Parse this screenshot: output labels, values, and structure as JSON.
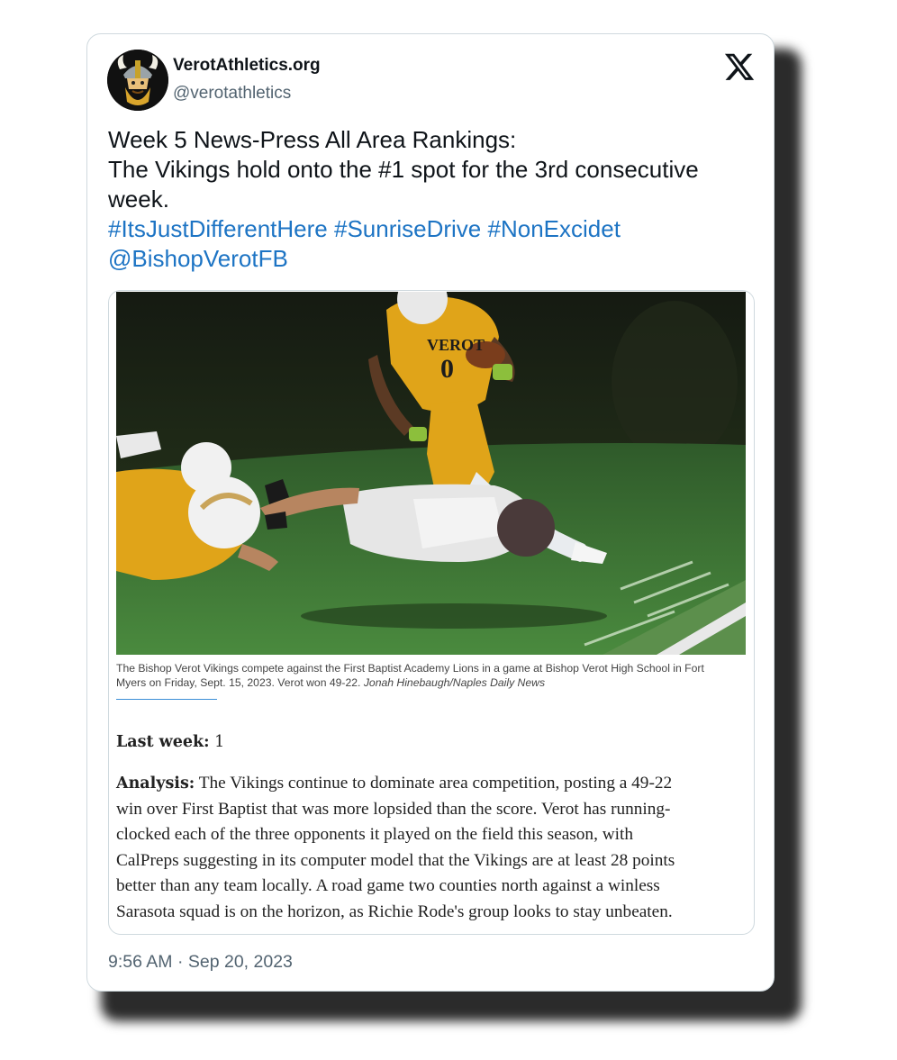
{
  "account": {
    "display_name": "VerotAthletics.org",
    "handle": "@verotathletics",
    "avatar_icon": "viking-mascot-icon"
  },
  "platform_icon": "x-logo-icon",
  "tweet": {
    "line1": "Week 5 News-Press All Area Rankings:",
    "line2": "The Vikings hold onto the #1 spot for the 3rd consecutive",
    "line3": "week.",
    "hashtags": [
      "#ItsJustDifferentHere",
      "#SunriseDrive",
      "#NonExcidet"
    ],
    "mention": "@BishopVerotFB"
  },
  "article": {
    "photo_jersey_text": "VEROT",
    "photo_jersey_number": "0",
    "caption_line1": "The Bishop Verot Vikings compete against the First Baptist Academy Lions in a game at Bishop Verot High School in Fort",
    "caption_line2": "Myers on Friday, Sept. 15, 2023. Verot won 49-22. ",
    "caption_credit": "Jonah Hinebaugh/Naples Daily News",
    "last_week_label": "Last week:",
    "last_week_value": "1",
    "analysis_label": "Analysis:",
    "analysis_lines": [
      " The Vikings continue to dominate area competition, posting a 49-22",
      "win over First Baptist that was more lopsided than the score. Verot has running-",
      "clocked each of the three opponents it played on the field this season, with",
      "CalPreps suggesting in its computer model that the Vikings are at least 28 points",
      "better than any team locally. A road game two counties north against a winless",
      "Sarasota squad is on the horizon, as Richie Rode's group looks to stay unbeaten."
    ]
  },
  "timestamp": "9:56 AM · Sep 20, 2023",
  "colors": {
    "link": "#1d74c4",
    "text": "#0f1419",
    "muted": "#536471",
    "jersey_gold": "#e0a419",
    "turf": "#3f7a3a"
  }
}
